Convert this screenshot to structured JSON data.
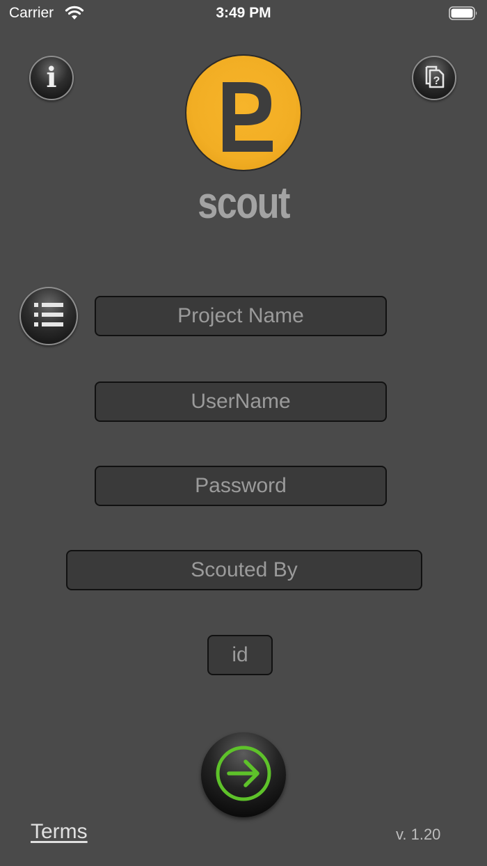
{
  "status_bar": {
    "carrier": "Carrier",
    "time": "3:49 PM"
  },
  "header": {
    "logo_text": "scout"
  },
  "form": {
    "project_name_placeholder": "Project Name",
    "username_placeholder": "UserName",
    "password_placeholder": "Password",
    "scouted_by_placeholder": "Scouted By",
    "id_placeholder": "id"
  },
  "footer": {
    "terms_label": "Terms",
    "version": "v. 1.20"
  },
  "colors": {
    "background": "#4a4a4a",
    "logo_orange": "#f2ae24",
    "go_arrow_green": "#5ec22a"
  },
  "icons": [
    "info-icon",
    "help-document-icon",
    "list-icon",
    "arrow-right-circle-icon",
    "wifi-icon",
    "battery-icon"
  ]
}
